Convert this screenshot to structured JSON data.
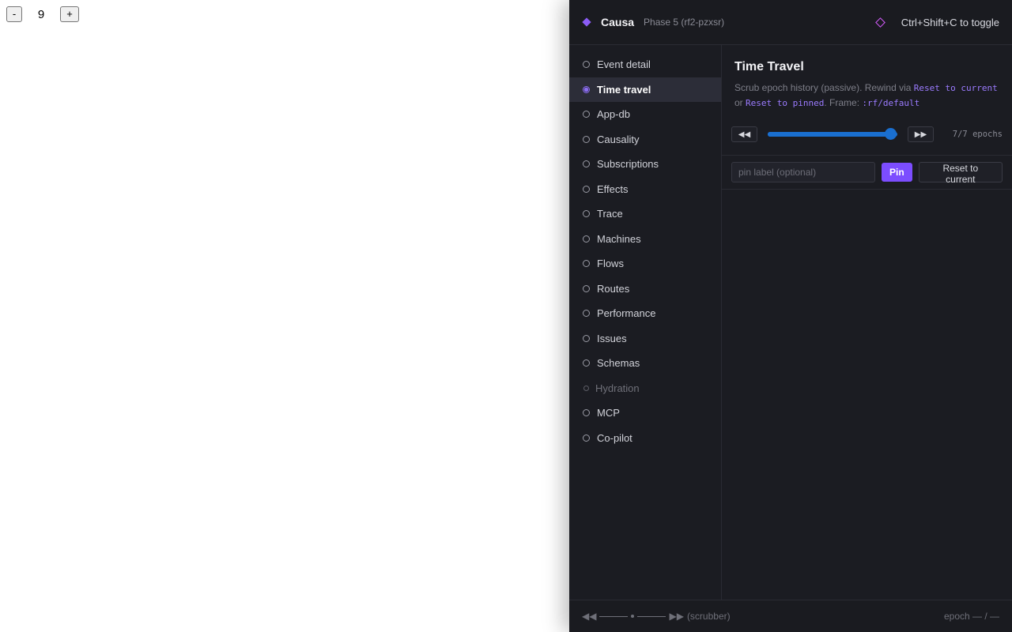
{
  "host": {
    "minus_label": "-",
    "count": "9",
    "plus_label": "+"
  },
  "header": {
    "brand": "Causa",
    "phase": "Phase 5 (rf2-pzxsr)",
    "toggle_hint": "Ctrl+Shift+C to toggle"
  },
  "sidebar": {
    "items": [
      {
        "label": "Event detail",
        "state": "normal"
      },
      {
        "label": "Time travel",
        "state": "active"
      },
      {
        "label": "App-db",
        "state": "normal"
      },
      {
        "label": "Causality",
        "state": "normal"
      },
      {
        "label": "Subscriptions",
        "state": "normal"
      },
      {
        "label": "Effects",
        "state": "normal"
      },
      {
        "label": "Trace",
        "state": "normal"
      },
      {
        "label": "Machines",
        "state": "normal"
      },
      {
        "label": "Flows",
        "state": "normal"
      },
      {
        "label": "Routes",
        "state": "normal"
      },
      {
        "label": "Performance",
        "state": "normal"
      },
      {
        "label": "Issues",
        "state": "normal"
      },
      {
        "label": "Schemas",
        "state": "normal"
      },
      {
        "label": "Hydration",
        "state": "disabled"
      },
      {
        "label": "MCP",
        "state": "normal"
      },
      {
        "label": "Co-pilot",
        "state": "normal"
      }
    ]
  },
  "main": {
    "title": "Time Travel",
    "desc_1": "Scrub epoch history (passive). Rewind via ",
    "desc_code_1": "Reset to current",
    "desc_2": "or ",
    "desc_code_2": "Reset to pinned",
    "desc_3": ". Frame: ",
    "desc_code_3": ":rf/default",
    "rewind_icon": "◀◀",
    "forward_icon": "▶▶",
    "slider_value": 1.0,
    "epochs_label": "7/7 epochs",
    "pin_placeholder": "pin label (optional)",
    "pin_label": "Pin",
    "reset_label": "Reset to current"
  },
  "footer": {
    "left_rewind": "◀◀",
    "left_forward": "▶▶",
    "left_text": "(scrubber)",
    "right_text": "epoch — / —"
  },
  "colors": {
    "accent": "#7c4dff",
    "slider": "#1a6fd0",
    "panel_bg": "#1b1c22"
  }
}
